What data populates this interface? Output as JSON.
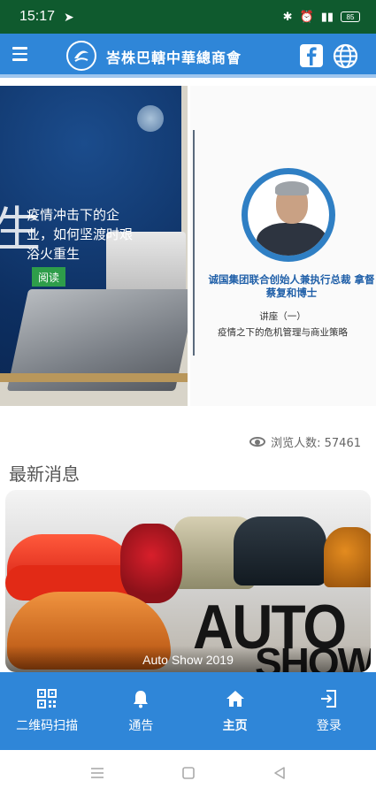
{
  "status_bar": {
    "time": "15:17",
    "icons": [
      "telegram-icon",
      "bluetooth-icon",
      "alarm-icon",
      "wifi-icon",
      "signal-icon"
    ],
    "battery": "85"
  },
  "app_bar": {
    "title": "峇株巴轄中華總商會",
    "icons": [
      "menu-icon",
      "logo-icon",
      "facebook-icon",
      "globe-icon"
    ]
  },
  "banner": {
    "left_slide": {
      "headline": "疫情冲击下的企业，如何坚渡时艰浴火重生",
      "big_char": "生",
      "read_button": "阅读"
    },
    "right_slide": {
      "speaker_name": "诚国集团联合创始人兼执行总裁 拿督蔡复和博士",
      "lecture_no": "讲座（一）",
      "lecture_topic": "疫情之下的危机管理与商业策略"
    }
  },
  "views": {
    "label": "浏览人数: 57461"
  },
  "latest_news": {
    "section_title": "最新消息",
    "items": [
      {
        "title": "Auto Show 2019",
        "image_word_1": "AUTO",
        "image_word_2": "SHOW"
      }
    ]
  },
  "bottom_nav": {
    "items": [
      {
        "label": "二维码扫描",
        "icon": "qr-code-icon"
      },
      {
        "label": "通告",
        "icon": "bell-icon"
      },
      {
        "label": "主页",
        "icon": "home-icon",
        "active": true
      },
      {
        "label": "登录",
        "icon": "login-icon"
      }
    ]
  },
  "colors": {
    "status_bar": "#0f5a2e",
    "primary": "#2f86d8",
    "accent_green": "#2e9d4a",
    "speaker_name": "#1f5fa8"
  }
}
